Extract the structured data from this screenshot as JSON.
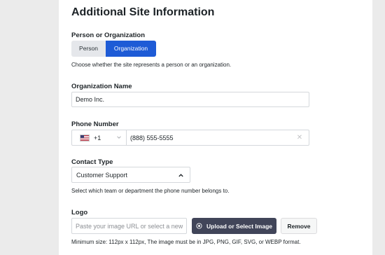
{
  "section": {
    "title": "Additional Site Information"
  },
  "person_org": {
    "label": "Person or Organization",
    "options": [
      "Person",
      "Organization"
    ],
    "selected": "Organization",
    "help": "Choose whether the site represents a person or an organization."
  },
  "org_name": {
    "label": "Organization Name",
    "value": "Demo Inc."
  },
  "phone": {
    "label": "Phone Number",
    "country_flag": "us-flag-icon",
    "dial_code": "+1",
    "value": "(888) 555-5555",
    "clear_symbol": "✕"
  },
  "contact_type": {
    "label": "Contact Type",
    "selected": "Customer Support",
    "help": "Select which team or department the phone number belongs to."
  },
  "logo": {
    "label": "Logo",
    "placeholder": "Paste your image URL or select a new",
    "upload_label": "Upload or Select Image",
    "remove_label": "Remove",
    "help": "Minimum size: 112px x 112px, The image must be in JPG, PNG, GIF, SVG, or WEBP format."
  },
  "colors": {
    "accent": "#1e5bd6",
    "upload_button": "#414559",
    "background": "#ebebeb"
  }
}
